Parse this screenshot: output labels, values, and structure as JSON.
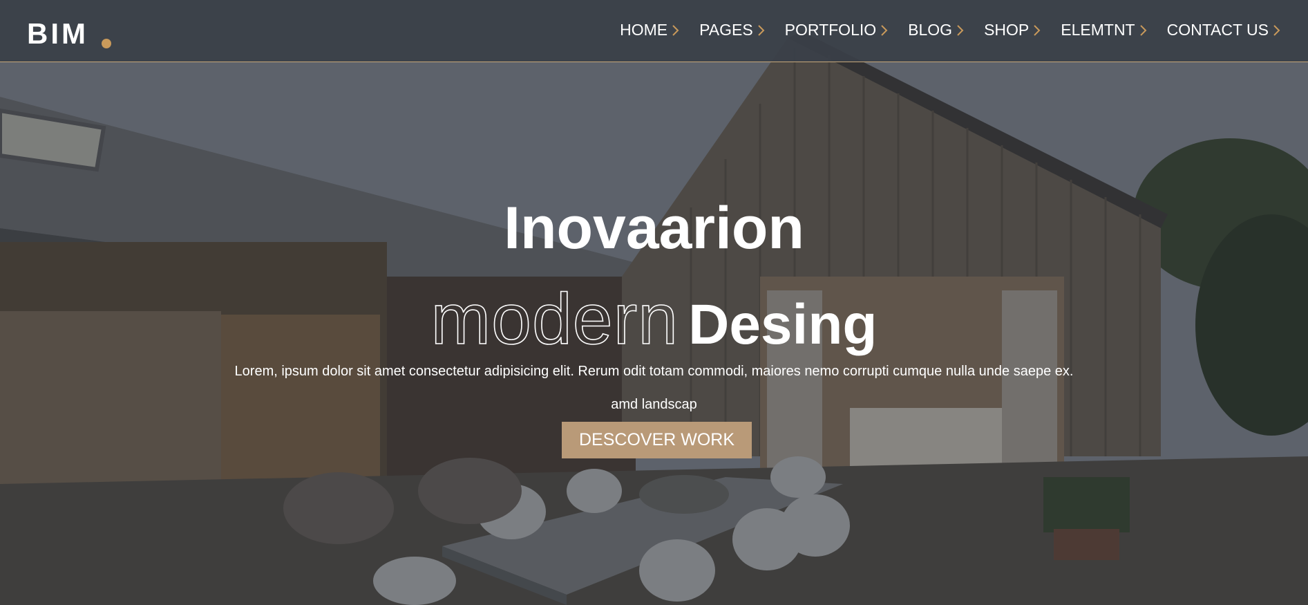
{
  "brand": {
    "logo_text": "BIM",
    "accent_color": "#c99a5b"
  },
  "nav": {
    "items": [
      {
        "label": "HOME",
        "icon": "chevron-right-icon"
      },
      {
        "label": "PAGES",
        "icon": "chevron-right-icon"
      },
      {
        "label": "PORTFOLIO",
        "icon": "chevron-right-icon"
      },
      {
        "label": "BLOG",
        "icon": "chevron-right-icon"
      },
      {
        "label": "SHOP",
        "icon": "chevron-right-icon"
      },
      {
        "label": "ELEMTNT",
        "icon": "chevron-right-icon"
      },
      {
        "label": "CONTACT US",
        "icon": "chevron-right-icon"
      }
    ],
    "chevron_color": "#c99a5b"
  },
  "hero": {
    "title_line1": "Inovaarion",
    "title_outline": "modern",
    "title_solid": "Desing",
    "paragraph": "Lorem, ipsum dolor sit amet consectetur adipisicing elit. Rerum odit totam commodi, maiores nemo corrupti cumque nulla unde saepe ex.",
    "subline": "amd landscap",
    "cta_label": "DESCOVER WORK",
    "cta_color": "#b99a78"
  }
}
